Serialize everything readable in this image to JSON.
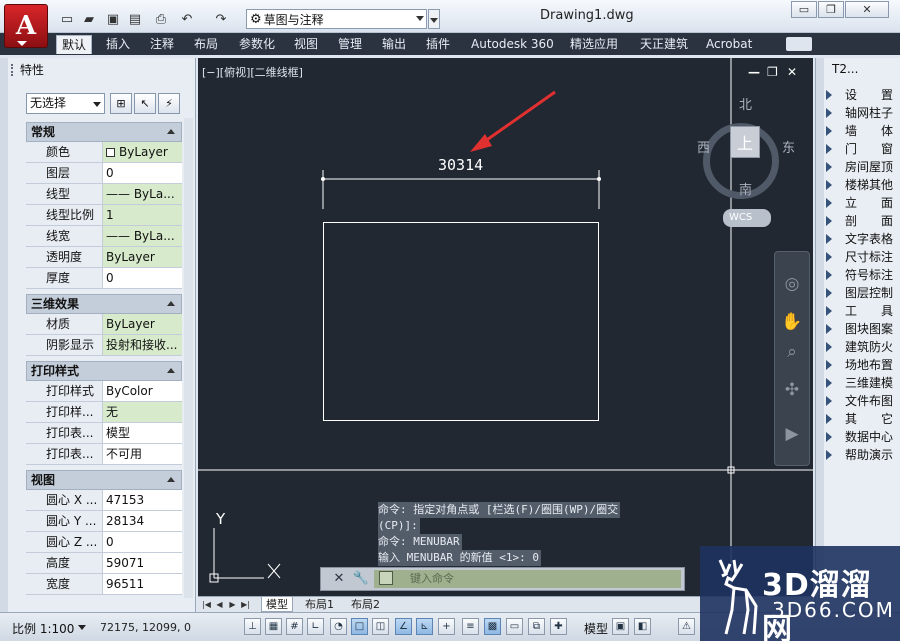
{
  "app": {
    "logo_letter": "A",
    "document_title": "Drawing1.dwg"
  },
  "quick_access": {
    "icons": [
      "new-icon",
      "open-icon",
      "save-icon",
      "saveas-icon",
      "print-icon",
      "undo-icon",
      "redo-icon"
    ],
    "workspace": "草图与注释"
  },
  "window_buttons": {
    "minimize": "▭",
    "restore": "❐",
    "close": "✕"
  },
  "ribbon": {
    "tabs": [
      "默认",
      "插入",
      "注释",
      "布局",
      "参数化",
      "视图",
      "管理",
      "输出",
      "插件",
      "Autodesk 360",
      "精选应用",
      "天正建筑",
      "Acrobat"
    ],
    "active_tab": 0
  },
  "properties": {
    "title": "特性",
    "selection": "无选择",
    "sections": {
      "general": "常规",
      "three_d": "三维效果",
      "plot": "打印样式",
      "view": "视图"
    },
    "general_rows": [
      {
        "label": "颜色",
        "value": "ByLayer",
        "swatch": true
      },
      {
        "label": "图层",
        "value": "0"
      },
      {
        "label": "线型",
        "value": "—— ByLa..."
      },
      {
        "label": "线型比例",
        "value": "1"
      },
      {
        "label": "线宽",
        "value": "—— ByLa..."
      },
      {
        "label": "透明度",
        "value": "ByLayer"
      },
      {
        "label": "厚度",
        "value": "0"
      }
    ],
    "three_d_rows": [
      {
        "label": "材质",
        "value": "ByLayer"
      },
      {
        "label": "阴影显示",
        "value": "投射和接收..."
      }
    ],
    "plot_rows": [
      {
        "label": "打印样式",
        "value": "ByColor"
      },
      {
        "label": "打印样...",
        "value": "无"
      },
      {
        "label": "打印表...",
        "value": "模型"
      },
      {
        "label": "打印表...",
        "value": "不可用"
      }
    ],
    "view_rows": [
      {
        "label": "圆心 X ...",
        "value": "47153"
      },
      {
        "label": "圆心 Y ...",
        "value": "28134"
      },
      {
        "label": "圆心 Z ...",
        "value": "0"
      },
      {
        "label": "高度",
        "value": "59071"
      },
      {
        "label": "宽度",
        "value": "96511"
      }
    ]
  },
  "viewport": {
    "label": "[−][俯视][二维线框]",
    "dimension_text": "30314",
    "compass": {
      "north": "北",
      "south": "南",
      "east": "东",
      "west": "西",
      "top": "上"
    },
    "wcs": "WCS",
    "axis_y": "Y",
    "annotation_color": "#e03030"
  },
  "command": {
    "history": [
      "命令: 指定对角点或 [栏选(F)/圈围(WP)/圈交",
      "(CP)]:",
      "命令: MENUBAR",
      "输入 MENUBAR 的新值 <1>: 0"
    ],
    "placeholder": "键入命令"
  },
  "tool_palette": {
    "title": "T2...",
    "items": [
      "设　　置",
      "轴网柱子",
      "墙　　体",
      "门　　窗",
      "房间屋顶",
      "楼梯其他",
      "立　　面",
      "剖　　面",
      "文字表格",
      "尺寸标注",
      "符号标注",
      "图层控制",
      "工　　具",
      "图块图案",
      "建筑防火",
      "场地布置",
      "三维建模",
      "文件布图",
      "其　　它",
      "数据中心",
      "帮助演示"
    ]
  },
  "layout_tabs": [
    "模型",
    "布局1",
    "布局2"
  ],
  "status_bar": {
    "scale": "比例 1:100",
    "coords": "72175, 12099, 0",
    "model": "模型"
  },
  "watermark": {
    "title": "3D溜溜网",
    "url": "3D66.COM"
  }
}
